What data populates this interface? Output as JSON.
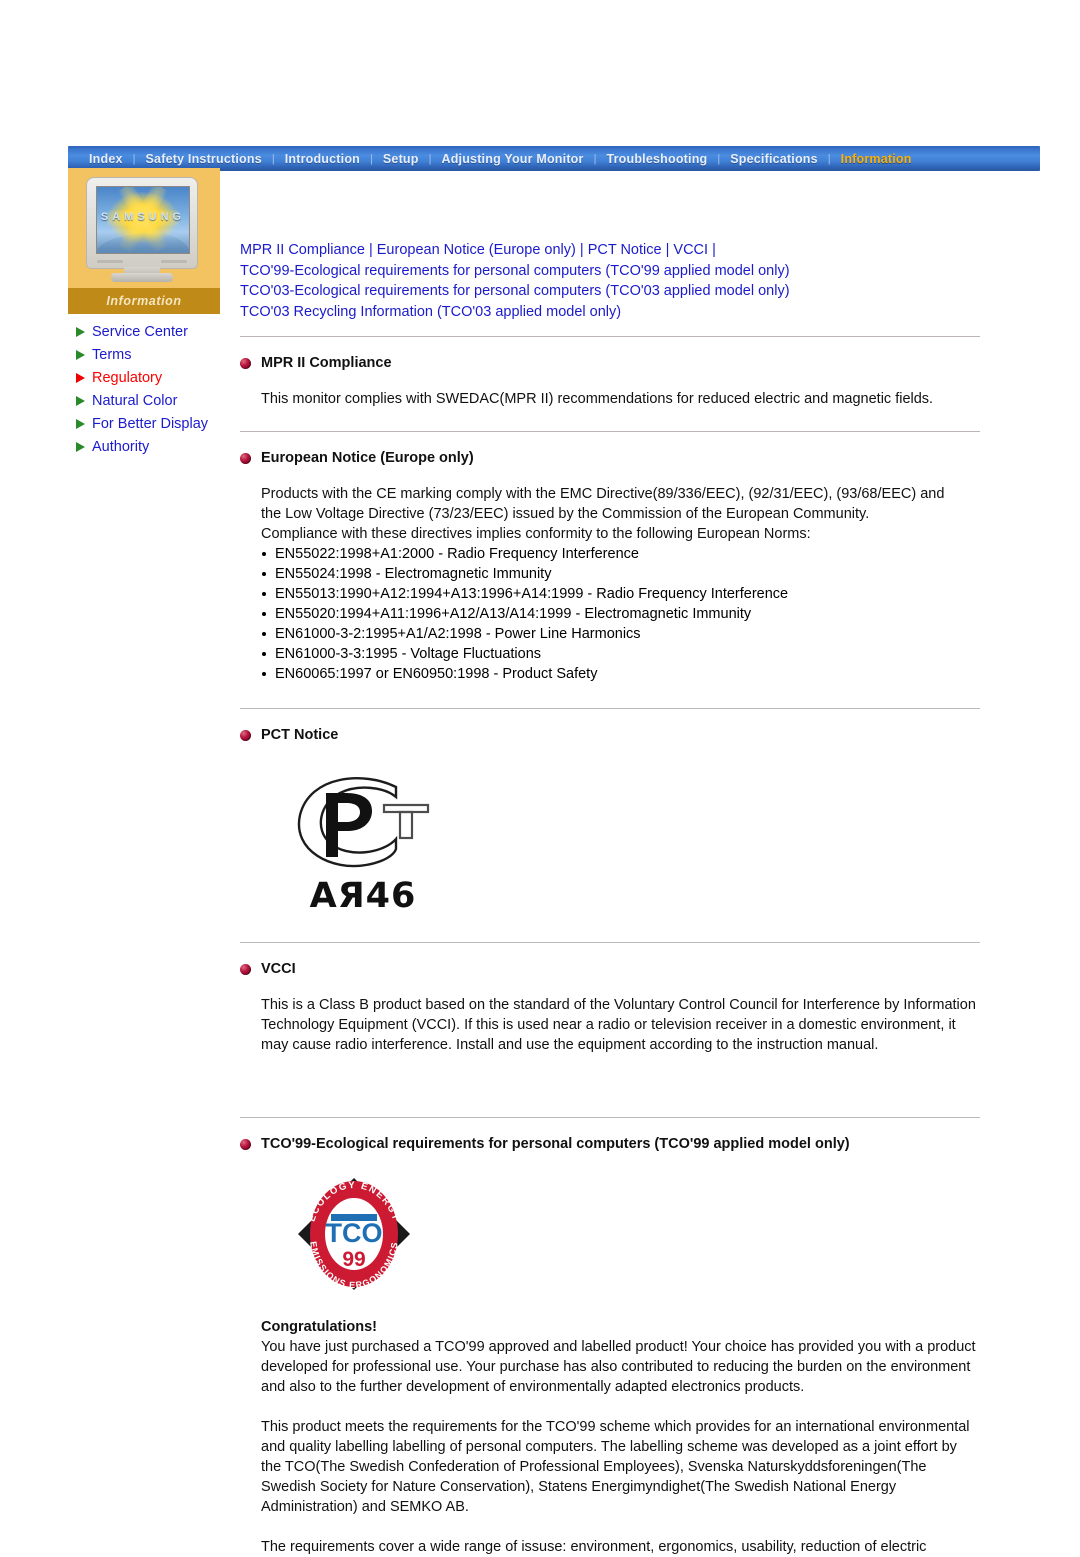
{
  "nav": {
    "items": [
      {
        "label": "Index",
        "active": false
      },
      {
        "label": "Safety Instructions",
        "active": false
      },
      {
        "label": "Introduction",
        "active": false
      },
      {
        "label": "Setup",
        "active": false
      },
      {
        "label": "Adjusting Your Monitor",
        "active": false
      },
      {
        "label": "Troubleshooting",
        "active": false
      },
      {
        "label": "Specifications",
        "active": false
      },
      {
        "label": "Information",
        "active": true
      }
    ],
    "separator": "|",
    "active_color": "#ffb000",
    "bar_color": "#3b76cf"
  },
  "sidebar": {
    "logo": {
      "brand": "SAMSUNG",
      "caption": "Information",
      "panel_color": "#f3c261",
      "band_color": "#c08a19"
    },
    "items": [
      {
        "label": "Service Center",
        "active": false
      },
      {
        "label": "Terms",
        "active": false
      },
      {
        "label": "Regulatory",
        "active": true
      },
      {
        "label": "Natural Color",
        "active": false
      },
      {
        "label": "For Better Display",
        "active": false
      },
      {
        "label": "Authority",
        "active": false
      }
    ],
    "link_color": "#1b1bcc",
    "active_color": "#ff0000",
    "arrow_color": "#2a8a2a"
  },
  "toplinks": {
    "line1": [
      "MPR II Compliance",
      "European Notice (Europe only)",
      "PCT Notice",
      "VCCI"
    ],
    "line2": "TCO'99-Ecological requirements for personal computers (TCO'99 applied model only)",
    "line3": "TCO'03-Ecological requirements for personal computers (TCO'03 applied model only)",
    "line4": "TCO'03 Recycling Information (TCO'03 applied model only)",
    "divider": "|"
  },
  "sections": {
    "mpr": {
      "heading": "MPR II Compliance",
      "body": "This monitor complies with SWEDAC(MPR II) recommendations for reduced electric and magnetic fields."
    },
    "european": {
      "heading": "European Notice (Europe only)",
      "intro_1": "Products with the CE marking comply with the EMC Directive(89/336/EEC), (92/31/EEC), (93/68/EEC) and",
      "intro_2": "the Low Voltage Directive (73/23/EEC) issued by the Commission of the European Community.",
      "intro_3": "Compliance with these directives implies conformity to the following European Norms:",
      "norms": [
        "EN55022:1998+A1:2000 - Radio Frequency Interference",
        "EN55024:1998 - Electromagnetic Immunity",
        "EN55013:1990+A12:1994+A13:1996+A14:1999 - Radio Frequency Interference",
        "EN55020:1994+A11:1996+A12/A13/A14:1999 - Electromagnetic Immunity",
        "EN61000-3-2:1995+A1/A2:1998 - Power Line Harmonics",
        "EN61000-3-3:1995 - Voltage Fluctuations",
        "EN60065:1997 or EN60950:1998 - Product Safety"
      ]
    },
    "pct": {
      "heading": "PCT Notice",
      "mark_letters": "PCT",
      "mark_code": "AЯ46"
    },
    "vcci": {
      "heading": "VCCI",
      "body": "This is a Class B product based on the standard of the Voluntary Control Council for Interference by Information Technology Equipment (VCCI). If this is used near a radio or television receiver in a domestic environment, it may cause radio interference. Install and use the equipment according to the instruction manual."
    },
    "tco99": {
      "heading": "TCO'99-Ecological requirements for personal computers (TCO'99 applied model only)",
      "logo": {
        "ring_top_text": "ECOLOGY ENERGY",
        "ring_bottom_text": "EMISSIONS ERGONOMICS",
        "center_text": "TCO",
        "year_text": "99",
        "ring_color": "#cc1a33",
        "center_color": "#1f6fb5"
      },
      "congrats_heading": "Congratulations!",
      "para1": "You have just purchased a TCO'99 approved and labelled product! Your choice has provided you with a product developed for professional use. Your purchase has also contributed to reducing the burden on the environment and also to the further development of environmentally adapted electronics products.",
      "para2": "This product meets the requirements for the TCO'99 scheme which provides for an international environmental and quality labelling labelling of personal computers. The labelling scheme was developed as a joint effort by the TCO(The Swedish Confederation of Professional Employees), Svenska Naturskyddsforeningen(The Swedish Society for Nature Conservation), Statens Energimyndighet(The Swedish National Energy Administration) and SEMKO AB.",
      "para3": "The requirements cover a wide range of issuse: environment, ergonomics, usability, reduction of electric"
    }
  }
}
